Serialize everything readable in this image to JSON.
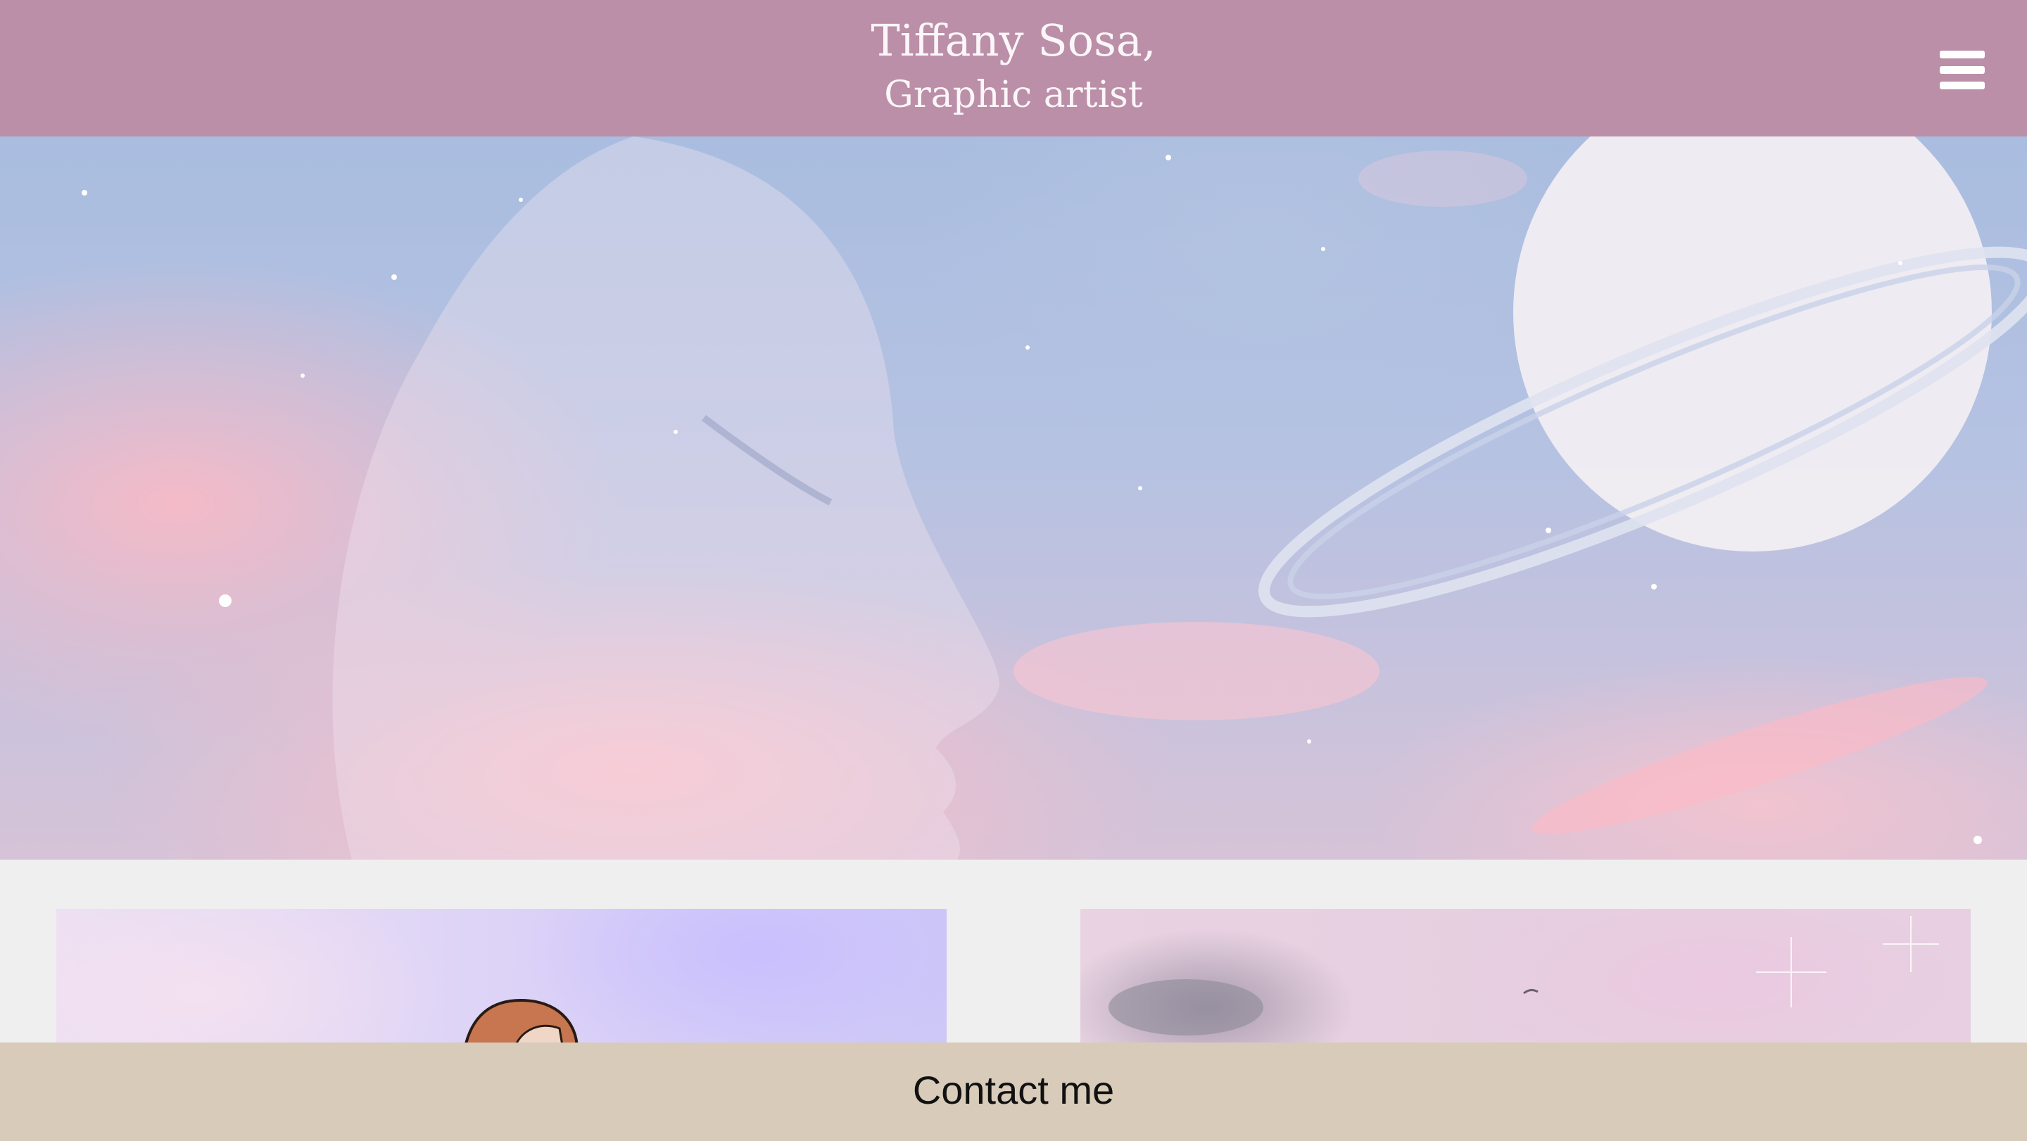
{
  "header": {
    "name": "Tiffany Sosa,",
    "role": "Graphic artist",
    "background_color": "#bb8fa7",
    "menu_icon": "hamburger-menu-icon"
  },
  "hero": {
    "image_subject": "dreamy pastel sky with a woman's face in profile, stars and a ringed planet"
  },
  "gallery": {
    "cards": [
      {
        "image_subject": "illustrated red-haired girl over lavender galaxy sky"
      },
      {
        "image_subject": "pink starry sky with clouds"
      }
    ]
  },
  "footer": {
    "contact_label": "Contact me",
    "background_color": "#d8cbba"
  }
}
